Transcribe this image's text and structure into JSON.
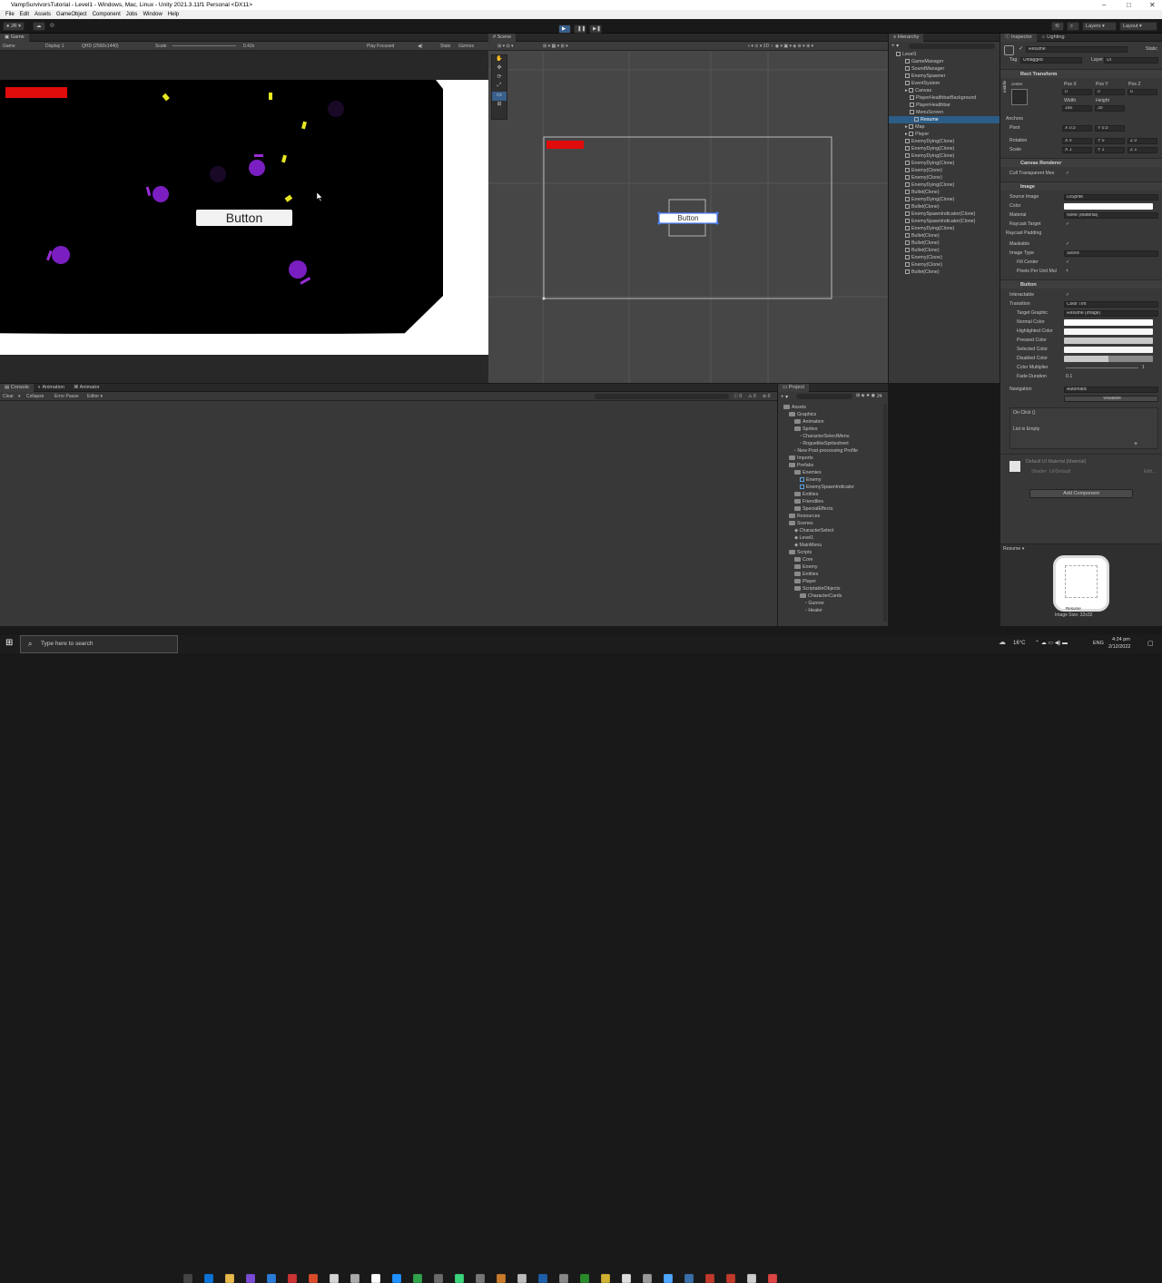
{
  "window": {
    "title": "VampSurvivorsTutorial - Level1 - Windows, Mac, Linux - Unity 2021.3.11f1 Personal <DX11>"
  },
  "menu": [
    "File",
    "Edit",
    "Assets",
    "GameObject",
    "Component",
    "Jobs",
    "Window",
    "Help"
  ],
  "toolbar": {
    "account": "JR",
    "layers": "Layers",
    "layout": "Layout"
  },
  "game": {
    "tab": "Game",
    "mode": "Game",
    "display": "Display 1",
    "resolution": "QHD (2560x1440)",
    "scale_label": "Scale",
    "scale_value": "0.42x",
    "play_focused": "Play Focused",
    "stats": "Stats",
    "gizmos": "Gizmos",
    "button_text": "Button"
  },
  "scene": {
    "tab": "Scene",
    "button_text": "Button"
  },
  "hierarchy": {
    "tab": "Hierarchy",
    "items": [
      {
        "label": "Level1",
        "indent": 0,
        "icon": "unity"
      },
      {
        "label": "GameManager",
        "indent": 2
      },
      {
        "label": "SoundManager",
        "indent": 2
      },
      {
        "label": "EnemySpawner",
        "indent": 2
      },
      {
        "label": "EventSystem",
        "indent": 2
      },
      {
        "label": "Canvas",
        "indent": 2
      },
      {
        "label": "PlayerHealthbarBackground",
        "indent": 3
      },
      {
        "label": "PlayerHealthbar",
        "indent": 3
      },
      {
        "label": "MenuScreen",
        "indent": 3
      },
      {
        "label": "Resume",
        "indent": 4,
        "selected": true
      },
      {
        "label": "Map",
        "indent": 2
      },
      {
        "label": "Player",
        "indent": 2
      },
      {
        "label": "EnemyDying(Clone)",
        "indent": 2
      },
      {
        "label": "EnemyDying(Clone)",
        "indent": 2
      },
      {
        "label": "EnemyDying(Clone)",
        "indent": 2
      },
      {
        "label": "EnemyDying(Clone)",
        "indent": 2
      },
      {
        "label": "Enemy(Clone)",
        "indent": 2
      },
      {
        "label": "Enemy(Clone)",
        "indent": 2
      },
      {
        "label": "EnemyDying(Clone)",
        "indent": 2
      },
      {
        "label": "Bullet(Clone)",
        "indent": 2
      },
      {
        "label": "EnemyDying(Clone)",
        "indent": 2
      },
      {
        "label": "Bullet(Clone)",
        "indent": 2
      },
      {
        "label": "EnemySpawnIndicator(Clone)",
        "indent": 2
      },
      {
        "label": "EnemySpawnIndicator(Clone)",
        "indent": 2
      },
      {
        "label": "EnemyDying(Clone)",
        "indent": 2
      },
      {
        "label": "Bullet(Clone)",
        "indent": 2
      },
      {
        "label": "Bullet(Clone)",
        "indent": 2
      },
      {
        "label": "Bullet(Clone)",
        "indent": 2
      },
      {
        "label": "Enemy(Clone)",
        "indent": 2
      },
      {
        "label": "Enemy(Clone)",
        "indent": 2
      },
      {
        "label": "Bullet(Clone)",
        "indent": 2
      }
    ]
  },
  "inspector": {
    "tabs": [
      "Inspector",
      "Lighting"
    ],
    "name": "Resume",
    "static": "Static",
    "tag_label": "Tag",
    "tag": "Untagged",
    "layer_label": "Layer",
    "layer": "UI",
    "rect": {
      "title": "Rect Transform",
      "center": "center",
      "middle": "middle",
      "posx_label": "Pos X",
      "posy_label": "Pos Y",
      "posz_label": "Pos Z",
      "posx": "0",
      "posy": "0",
      "posz": "0",
      "width_label": "Width",
      "height_label": "Height",
      "width": "160",
      "height": "30",
      "anchors": "Anchors",
      "pivot": "Pivot",
      "pivot_x": "X 0.5",
      "pivot_y": "Y 0.5",
      "rotation": "Rotation",
      "rot_x": "X 0",
      "rot_y": "Y 0",
      "rot_z": "Z 0",
      "scale": "Scale",
      "scale_x": "X 1",
      "scale_y": "Y 1",
      "scale_z": "Z 1"
    },
    "canvas_renderer": {
      "title": "Canvas Renderer",
      "cull": "Cull Transparent Mes"
    },
    "image": {
      "title": "Image",
      "source_label": "Source Image",
      "source": "UISprite",
      "color_label": "Color",
      "material_label": "Material",
      "material": "None (Material)",
      "raycast_target": "Raycast Target",
      "raycast_padding": "Raycast Padding",
      "maskable": "Maskable",
      "type_label": "Image Type",
      "type": "Sliced",
      "fill_center": "Fill Center",
      "ppu_label": "Pixels Per Unit Mul",
      "ppu": "1"
    },
    "button": {
      "title": "Button",
      "interactable": "Interactable",
      "transition_label": "Transition",
      "transition": "Color Tint",
      "target_label": "Target Graphic",
      "target": "Resume (Image)",
      "normal": "Normal Color",
      "highlighted": "Highlighted Color",
      "pressed": "Pressed Color",
      "selected": "Selected Color",
      "disabled": "Disabled Color",
      "multiplier_label": "Color Multiplier",
      "multiplier": "1",
      "fade_label": "Fade Duration",
      "fade": "0.1",
      "nav_label": "Navigation",
      "nav": "Automatic",
      "visualize": "Visualize",
      "onclick": "On Click ()",
      "list_empty": "List is Empty"
    },
    "material": {
      "name": "Default UI Material (Material)",
      "shader_label": "Shader",
      "shader": "UI/Default",
      "edit": "Edit..."
    },
    "add_component": "Add Component",
    "preview": {
      "title": "Resume",
      "image_label": "Resume",
      "image_size": "Image Size: 32x32"
    }
  },
  "console": {
    "tabs": [
      "Console",
      "Animation",
      "Animator"
    ],
    "clear": "Clear",
    "collapse": "Collapse",
    "error_pause": "Error Pause",
    "editor": "Editor",
    "counts": [
      "0",
      "0",
      "0"
    ]
  },
  "project": {
    "tab": "Project",
    "count": "24",
    "tree": [
      {
        "label": "Assets",
        "indent": 0,
        "type": "folder"
      },
      {
        "label": "Graphics",
        "indent": 1,
        "type": "folder"
      },
      {
        "label": "Animation",
        "indent": 2,
        "type": "folder"
      },
      {
        "label": "Sprites",
        "indent": 2,
        "type": "folder"
      },
      {
        "label": "CharacterSelectMenu",
        "indent": 3,
        "type": "file"
      },
      {
        "label": "RoguelikeSpritesheet",
        "indent": 3,
        "type": "file"
      },
      {
        "label": "New Post-processing Profile",
        "indent": 2,
        "type": "file"
      },
      {
        "label": "Imports",
        "indent": 1,
        "type": "folder"
      },
      {
        "label": "Prefabs",
        "indent": 1,
        "type": "folder"
      },
      {
        "label": "Enemies",
        "indent": 2,
        "type": "folder"
      },
      {
        "label": "Enemy",
        "indent": 3,
        "type": "prefab"
      },
      {
        "label": "EnemySpawnIndicator",
        "indent": 3,
        "type": "prefab"
      },
      {
        "label": "Entities",
        "indent": 2,
        "type": "folder"
      },
      {
        "label": "Friendlies",
        "indent": 2,
        "type": "folder"
      },
      {
        "label": "SpecialEffects",
        "indent": 2,
        "type": "folder"
      },
      {
        "label": "Resources",
        "indent": 1,
        "type": "folder"
      },
      {
        "label": "Scenes",
        "indent": 1,
        "type": "folder"
      },
      {
        "label": "CharacterSelect",
        "indent": 2,
        "type": "scene"
      },
      {
        "label": "Level1",
        "indent": 2,
        "type": "scene"
      },
      {
        "label": "MainMenu",
        "indent": 2,
        "type": "scene"
      },
      {
        "label": "Scripts",
        "indent": 1,
        "type": "folder"
      },
      {
        "label": "Core",
        "indent": 2,
        "type": "folder"
      },
      {
        "label": "Enemy",
        "indent": 2,
        "type": "folder"
      },
      {
        "label": "Entities",
        "indent": 2,
        "type": "folder"
      },
      {
        "label": "Player",
        "indent": 2,
        "type": "folder"
      },
      {
        "label": "ScriptableObjects",
        "indent": 2,
        "type": "folder"
      },
      {
        "label": "CharacterCards",
        "indent": 3,
        "type": "folder"
      },
      {
        "label": "Gunner",
        "indent": 4,
        "type": "file"
      },
      {
        "label": "Healer",
        "indent": 4,
        "type": "file"
      }
    ]
  },
  "taskbar": {
    "search_placeholder": "Type here to search",
    "temp": "16°C",
    "lang": "ENG",
    "time": "4:24 pm",
    "date": "2/12/2022"
  },
  "colors": {
    "health": "#e00b0b",
    "purple": "#6b22a6",
    "bullet": "#e8e820",
    "selection": "#2c5d87",
    "accent": "#4c7fff"
  }
}
